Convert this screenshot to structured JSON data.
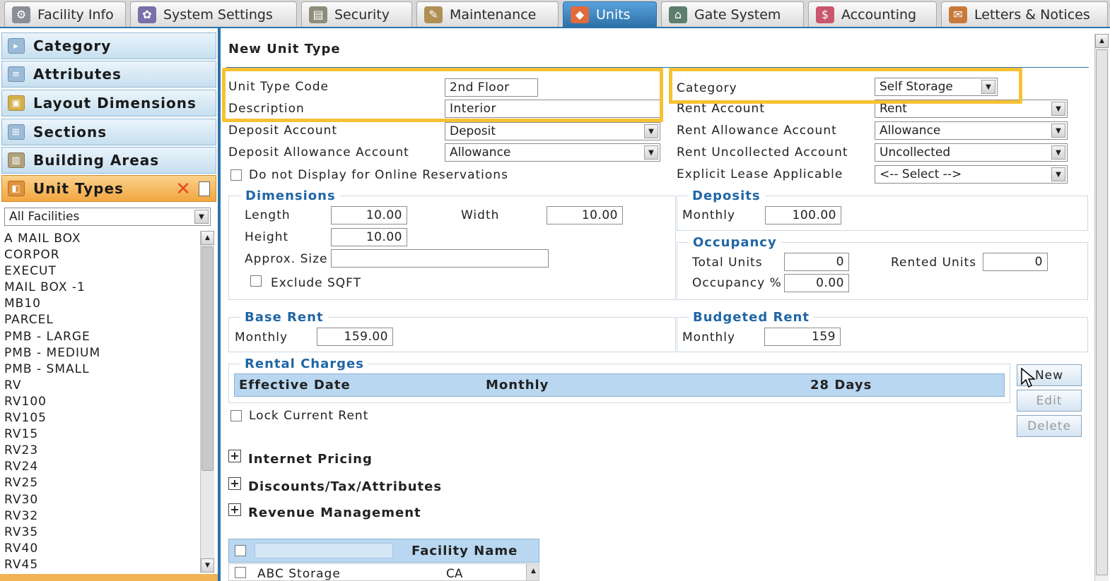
{
  "tabs": [
    {
      "label": "Facility Info",
      "icon": "facility-icon",
      "active": false
    },
    {
      "label": "System Settings",
      "icon": "settings-gear-icon",
      "active": false
    },
    {
      "label": "Security",
      "icon": "security-icon",
      "active": false
    },
    {
      "label": "Maintenance",
      "icon": "maintenance-icon",
      "active": false
    },
    {
      "label": "Units",
      "icon": "units-icon",
      "active": true
    },
    {
      "label": "Gate System",
      "icon": "gate-icon",
      "active": false
    },
    {
      "label": "Accounting",
      "icon": "accounting-icon",
      "active": false
    },
    {
      "label": "Letters & Notices",
      "icon": "letters-icon",
      "active": false
    }
  ],
  "sidebar": {
    "items": [
      {
        "label": "Category",
        "icon": "category-icon"
      },
      {
        "label": "Attributes",
        "icon": "attributes-icon"
      },
      {
        "label": "Layout Dimensions",
        "icon": "layout-icon"
      },
      {
        "label": "Sections",
        "icon": "sections-icon"
      },
      {
        "label": "Building Areas",
        "icon": "building-icon"
      },
      {
        "label": "Unit Types",
        "icon": "unit-types-icon",
        "active": true
      }
    ],
    "facility_filter": "All Facilities",
    "unit_types": [
      "A MAIL BOX",
      "CORPOR",
      "EXECUT",
      "MAIL BOX -1",
      "MB10",
      "PARCEL",
      "PMB - LARGE",
      "PMB - MEDIUM",
      "PMB - SMALL",
      "RV",
      "RV100",
      "RV105",
      "RV15",
      "RV23",
      "RV24",
      "RV25",
      "RV30",
      "RV32",
      "RV35",
      "RV40",
      "RV45"
    ]
  },
  "form": {
    "title": "New Unit Type",
    "unit_type_code_label": "Unit Type Code",
    "unit_type_code": "2nd Floor",
    "description_label": "Description",
    "description": "Interior",
    "deposit_account_label": "Deposit Account",
    "deposit_account": "Deposit",
    "deposit_allowance_label": "Deposit Allowance Account",
    "deposit_allowance": "Allowance",
    "online_res_label": "Do not Display for Online Reservations",
    "category_label": "Category",
    "category": "Self Storage",
    "rent_account_label": "Rent Account",
    "rent_account": "Rent",
    "rent_allowance_label": "Rent Allowance Account",
    "rent_allowance": "Allowance",
    "rent_uncollected_label": "Rent Uncollected Account",
    "rent_uncollected": "Uncollected",
    "explicit_lease_label": "Explicit Lease Applicable",
    "explicit_lease": "<-- Select -->"
  },
  "dimensions": {
    "title": "Dimensions",
    "length_label": "Length",
    "length": "10.00",
    "width_label": "Width",
    "width": "10.00",
    "height_label": "Height",
    "height": "10.00",
    "approx_label": "Approx. Size",
    "approx": "",
    "exclude_label": "Exclude SQFT"
  },
  "deposits": {
    "title": "Deposits",
    "monthly_label": "Monthly",
    "monthly": "100.00"
  },
  "occupancy": {
    "title": "Occupancy",
    "total_label": "Total Units",
    "total": "0",
    "rented_label": "Rented Units",
    "rented": "0",
    "pct_label": "Occupancy %",
    "pct": "0.00"
  },
  "base_rent": {
    "title": "Base Rent",
    "monthly_label": "Monthly",
    "monthly": "159.00"
  },
  "budgeted_rent": {
    "title": "Budgeted Rent",
    "monthly_label": "Monthly",
    "monthly": "159"
  },
  "rental_charges": {
    "title": "Rental Charges",
    "columns": [
      "Effective Date",
      "Monthly",
      "28 Days"
    ],
    "lock_label": "Lock Current Rent",
    "buttons": {
      "new": "New",
      "edit": "Edit",
      "delete": "Delete"
    }
  },
  "sections": [
    "Internet Pricing",
    "Discounts/Tax/Attributes",
    "Revenue Management"
  ],
  "facility_grid": {
    "header": "Facility Name",
    "rows": [
      {
        "name": "ABC Storage",
        "state": "CA"
      }
    ]
  },
  "colors": {
    "accent": "#2d71a8",
    "highlight": "#f6c233",
    "active_nav": "#f2a640"
  }
}
